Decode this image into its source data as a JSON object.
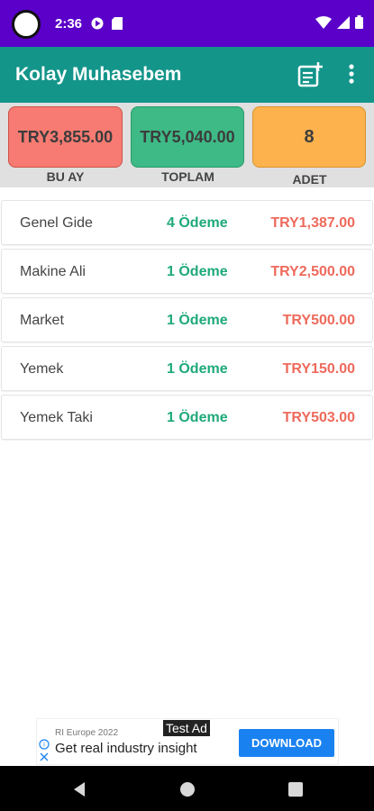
{
  "status_bar": {
    "time": "2:36"
  },
  "app_bar": {
    "title": "Kolay Muhasebem"
  },
  "summary": {
    "month": {
      "value": "TRY3,855.00",
      "label": "BU AY"
    },
    "total": {
      "value": "TRY5,040.00",
      "label": "TOPLAM"
    },
    "count": {
      "value": "8",
      "label": "ADET"
    }
  },
  "items": [
    {
      "name": "Genel Gide",
      "payments": "4 Ödeme",
      "amount": "TRY1,387.00"
    },
    {
      "name": "Makine Ali",
      "payments": "1 Ödeme",
      "amount": "TRY2,500.00"
    },
    {
      "name": "Market",
      "payments": "1 Ödeme",
      "amount": "TRY500.00"
    },
    {
      "name": "Yemek",
      "payments": "1 Ödeme",
      "amount": "TRY150.00"
    },
    {
      "name": "Yemek Taki",
      "payments": "1 Ödeme",
      "amount": "TRY503.00"
    }
  ],
  "ad": {
    "sponsor": "RI Europe 2022",
    "headline": "Get real industry insight",
    "test_label": "Test Ad",
    "cta": "DOWNLOAD"
  },
  "colors": {
    "status_bar": "#5a00c8",
    "app_bar": "#13958a",
    "card_month": "#f77b72",
    "card_total": "#3dba86",
    "card_count": "#fdb24d",
    "payments_text": "#1fa97a",
    "amount_text": "#ee6a5c",
    "ad_button": "#1a82f0"
  },
  "icons": {
    "status_left": [
      "google-play-icon",
      "sd-card-icon"
    ],
    "status_right": [
      "wifi-icon",
      "signal-icon",
      "battery-icon"
    ],
    "app_bar": [
      "add-note-icon",
      "more-vert-icon"
    ],
    "nav": [
      "back-icon",
      "home-icon",
      "recents-icon"
    ]
  }
}
